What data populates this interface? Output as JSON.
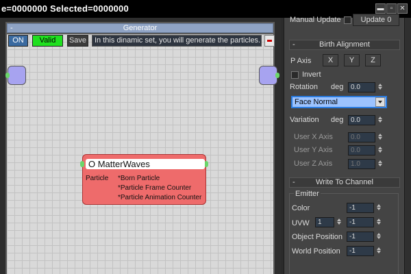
{
  "window": {
    "title": "e=0000000  Selected=0000000",
    "buttons": [
      "▬",
      "▫",
      "✕"
    ]
  },
  "generator": {
    "header": "Generator",
    "collapse_symbol": "-",
    "toolbar": {
      "on_label": "ON",
      "valid_label": "Valid",
      "save_label": "Save",
      "description": "In this dinamic set, you will generate the particles."
    },
    "node": {
      "title": "O MatterWaves",
      "label": "Particle",
      "items": [
        "*Born Particle",
        "*Particle Frame Counter",
        "*Particle Animation Counter"
      ]
    }
  },
  "panel": {
    "top_row": {
      "manual_update": "Manual Update",
      "update_label": "Update  0"
    },
    "birth_alignment": {
      "header": "Birth Alignment",
      "collapse_symbol": "-",
      "p_axis_label": "P Axis",
      "axes": [
        "X",
        "Y",
        "Z"
      ],
      "invert_label": "Invert",
      "rotation_label": "Rotation",
      "rotation_unit": "deg",
      "rotation_value": "0.0",
      "mode_selected": "Face Normal",
      "variation_label": "Variation",
      "variation_unit": "deg",
      "variation_value": "0.0",
      "user_x_label": "User X Axis",
      "user_x_value": "0.0",
      "user_y_label": "User Y Axis",
      "user_y_value": "0.0",
      "user_z_label": "User Z Axis",
      "user_z_value": "1.0"
    },
    "write_to_channel": {
      "header": "Write To Channel",
      "collapse_symbol": "-",
      "emitter_label": "Emitter",
      "color_label": "Color",
      "color_value": "-1",
      "uvw_label": "UVW",
      "uvw_channel": "1",
      "uvw_value": "-1",
      "object_position_label": "Object Position",
      "object_position_value": "-1",
      "world_position_label": "World Position",
      "world_position_value": "-1"
    }
  }
}
